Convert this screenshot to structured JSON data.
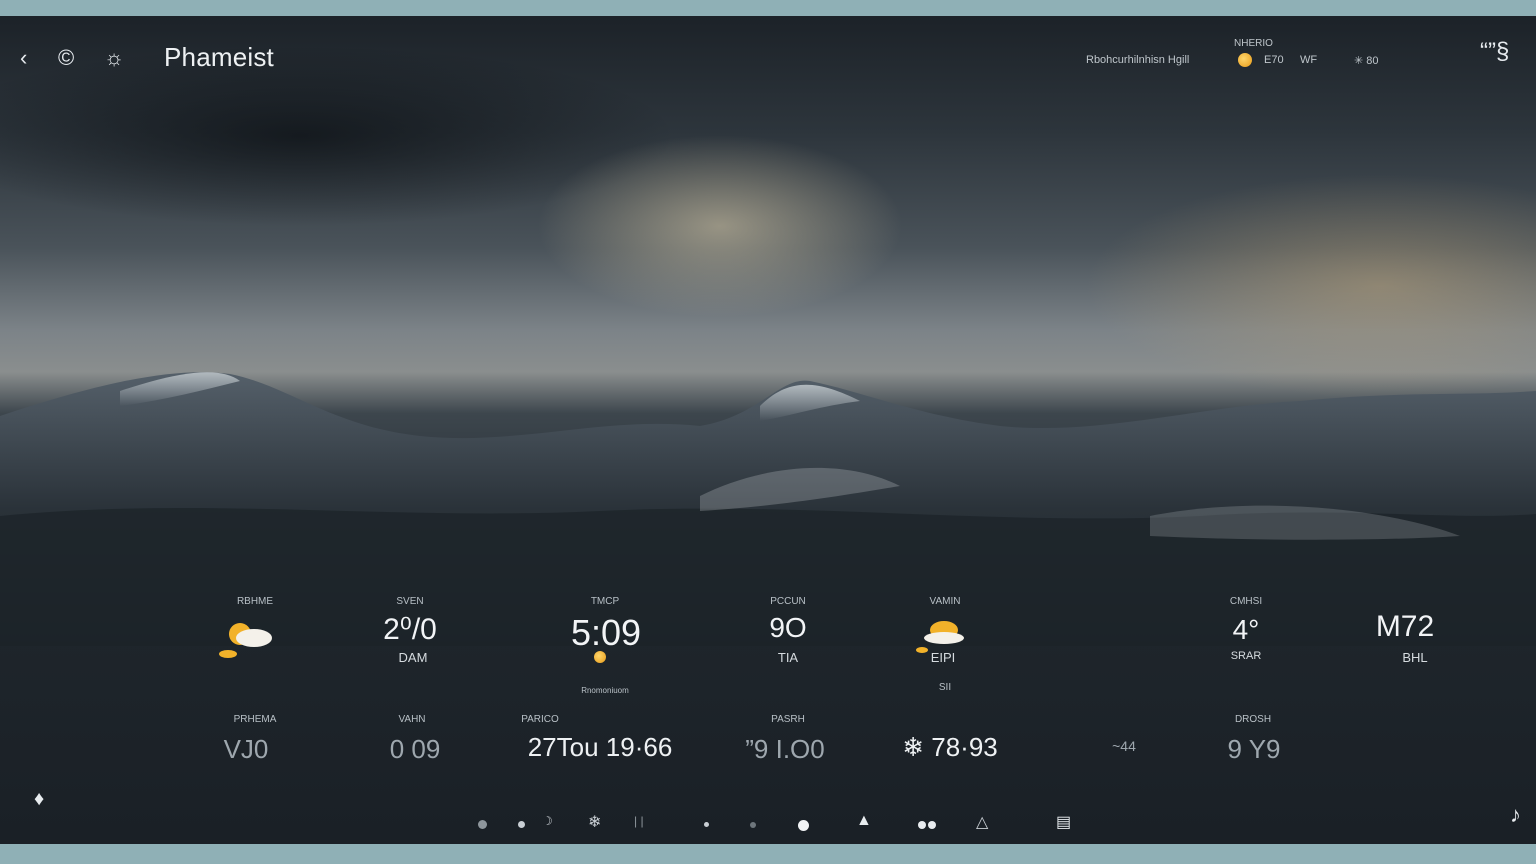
{
  "app": {
    "title": "Phameist"
  },
  "topbar": {
    "icons": [
      "back-arrow-icon",
      "refresh-icon",
      "sun-settings-icon"
    ],
    "location_text": "Rbohcurhilnhisn Hgill",
    "current_label": "NHERIO",
    "current_temp": "E70",
    "current_unit": "WF",
    "wind_text": "✳ 80",
    "right_glyph": "“”§"
  },
  "forecast_row1": [
    {
      "label": "RBHME",
      "icon": "partly-cloudy-sun-icon",
      "value": "",
      "sub": ""
    },
    {
      "label": "SVEN",
      "value": "2⁰/0",
      "sub": "DAM"
    },
    {
      "label": "TMCP",
      "value": "5:09",
      "sub": ""
    },
    {
      "label": "PCCUN",
      "value": "9O",
      "sub": "TIA"
    },
    {
      "label": "VAMIN",
      "icon": "sun-behind-cloud-icon",
      "value": "",
      "sub": "EIPI"
    },
    {
      "label": "CMHSI",
      "value": "4°",
      "sub": "SRAR"
    },
    {
      "label": "",
      "value": "M72",
      "sub": "BHL"
    }
  ],
  "mid_note": "SII",
  "small_note": "Rnomoniuom",
  "forecast_row2": [
    {
      "label": "PRHEMA",
      "value": "VJ0"
    },
    {
      "label": "VAHN",
      "value": "0 09"
    },
    {
      "label": "PARICO",
      "value": "27Tou 19·66"
    },
    {
      "label": "PASRH",
      "value": "”9 I.O0"
    },
    {
      "label": "",
      "value": "❄ 78·93"
    },
    {
      "label": "",
      "value": "~44"
    },
    {
      "label": "DROSH",
      "value": "9 Y9"
    }
  ],
  "bottom": {
    "left_icon": "drop-lock-icon",
    "right_icon": "music-note-icon",
    "nav_icons": [
      "dot",
      "dot",
      "moon-icon",
      "wind-icon",
      "dash",
      "dot",
      "dot",
      "sun-dot",
      "flame-icon",
      "double-dot",
      "triangle-icon",
      "chart-icon"
    ]
  },
  "colors": {
    "sun": "#f2b22a",
    "cloud": "#f4f1ea",
    "text": "#e8ecef",
    "muted": "#9ea7ae",
    "frame": "#8fb0b6"
  }
}
